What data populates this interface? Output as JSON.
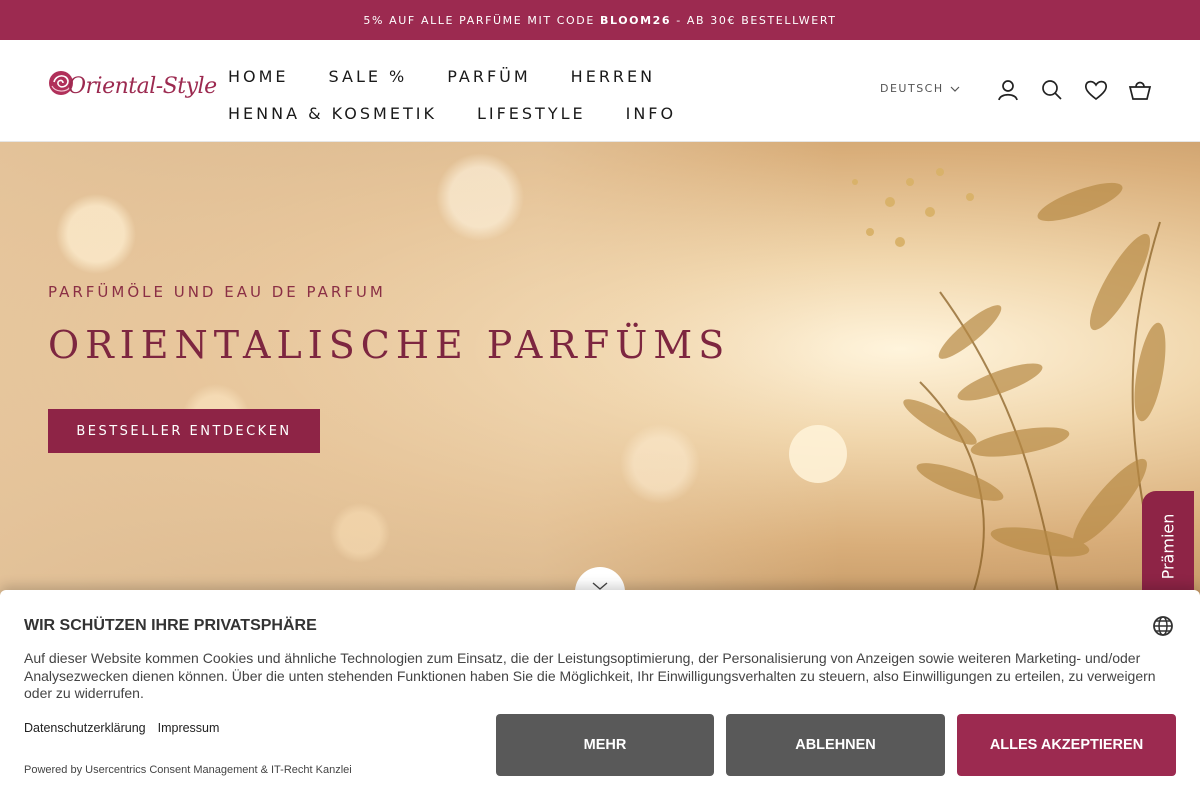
{
  "announcement": {
    "text_before": "5% AUF ALLE PARFÜME MIT CODE ",
    "code": "BLOOM26",
    "text_after": " - AB 30€ BESTELLWERT"
  },
  "logo": {
    "text": "Oriental-Style"
  },
  "nav": {
    "row1": [
      "HOME",
      "SALE %",
      "PARFÜM",
      "HERREN"
    ],
    "row2": [
      "HENNA & KOSMETIK",
      "LIFESTYLE",
      "INFO"
    ]
  },
  "header": {
    "language": "DEUTSCH",
    "icons": [
      "account-icon",
      "search-icon",
      "heart-icon",
      "cart-icon"
    ]
  },
  "hero": {
    "kicker": "PARFÜMÖLE UND EAU DE PARFUM",
    "title": "ORIENTALISCHE PARFÜMS",
    "button": "BESTSELLER ENTDECKEN"
  },
  "rewards_tab": {
    "label": "Prämien"
  },
  "consent": {
    "title": "WIR SCHÜTZEN IHRE PRIVATSPHÄRE",
    "text": "Auf dieser Website kommen Cookies und ähnliche Technologien zum Einsatz, die der Leistungsoptimierung, der Personalisierung von Anzeigen sowie weiteren Marketing- und/oder Analysezwecken dienen können. Über die unten stehenden Funktionen haben Sie die Möglichkeit, Ihr Einwilligungsverhalten zu steuern, also Einwilligungen zu erteilen, zu verweigern oder zu widerrufen.",
    "link_privacy": "Datenschutzerklärung",
    "link_imprint": "Impressum",
    "powered_by": "Powered by Usercentrics Consent Management & IT-Recht Kanzlei",
    "btn_more": "MEHR",
    "btn_deny": "ABLEHNEN",
    "btn_accept": "ALLES AKZEPTIEREN"
  },
  "colors": {
    "brand": "#9c2a50",
    "button_gray": "#595959"
  }
}
